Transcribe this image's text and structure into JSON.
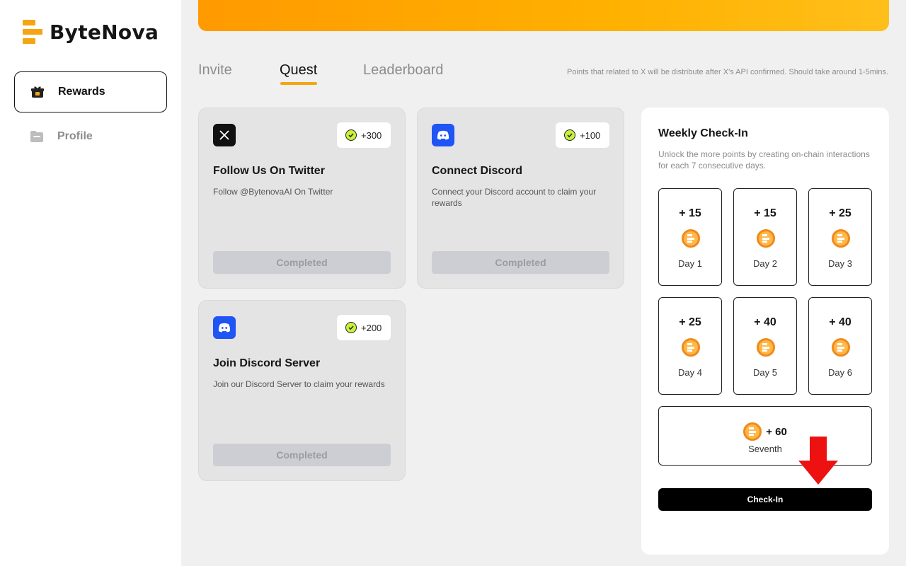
{
  "brand": {
    "name": "ByteNova",
    "color": "#f5a511"
  },
  "sidebar": {
    "items": [
      {
        "label": "Rewards",
        "icon": "gift-icon",
        "active": true
      },
      {
        "label": "Profile",
        "icon": "folder-icon",
        "active": false
      }
    ]
  },
  "tabs": [
    {
      "label": "Invite",
      "active": false
    },
    {
      "label": "Quest",
      "active": true
    },
    {
      "label": "Leaderboard",
      "active": false
    }
  ],
  "note": "Points that related to X will be distribute after X's API confirmed. Should take around 1-5mins.",
  "quests": [
    {
      "title": "Follow Us On Twitter",
      "description": "Follow @BytenovaAI On Twitter",
      "points": "+300",
      "icon": "x-logo-icon",
      "status": "Completed"
    },
    {
      "title": "Connect Discord",
      "description": "Connect your Discord account to claim your rewards",
      "points": "+100",
      "icon": "discord-icon",
      "status": "Completed"
    },
    {
      "title": "Join Discord Server",
      "description": "Join our Discord Server to claim your rewards",
      "points": "+200",
      "icon": "discord-icon",
      "status": "Completed"
    }
  ],
  "checkin": {
    "title": "Weekly Check-In",
    "description": "Unlock the more points by creating on-chain interactions for each 7 consecutive days.",
    "days": [
      {
        "points": "+ 15",
        "label": "Day 1"
      },
      {
        "points": "+ 15",
        "label": "Day 2"
      },
      {
        "points": "+ 25",
        "label": "Day 3"
      },
      {
        "points": "+ 25",
        "label": "Day 4"
      },
      {
        "points": "+ 40",
        "label": "Day 5"
      },
      {
        "points": "+ 40",
        "label": "Day 6"
      }
    ],
    "seventh": {
      "points": "+ 60",
      "label": "Seventh"
    },
    "button_label": "Check-In"
  },
  "colors": {
    "accent": "#f5a511",
    "discord": "#1f54f5",
    "coin": "#f08a1a",
    "arrow": "#ee1111"
  }
}
